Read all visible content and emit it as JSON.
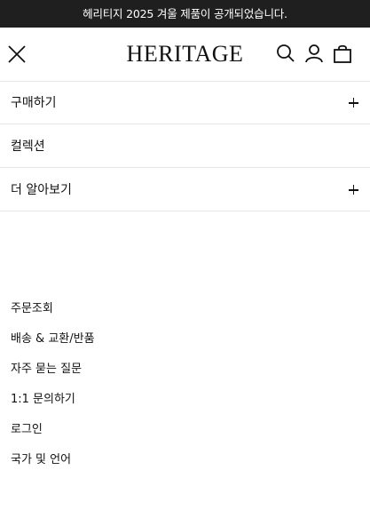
{
  "announcement": "헤리티지 2025 겨울 제품이 공개되었습니다.",
  "header": {
    "logo": "HERITAGE",
    "icons": [
      "close-icon",
      "search-icon",
      "account-icon",
      "bag-icon"
    ]
  },
  "menu": {
    "items": [
      {
        "label": "구매하기",
        "expandable": true
      },
      {
        "label": "컬렉션",
        "expandable": false
      },
      {
        "label": "더 알아보기",
        "expandable": true
      }
    ]
  },
  "footer_links": [
    "주문조회",
    "배송 & 교환/반품",
    "자주 묻는 질문",
    "1:1 문의하기",
    "로그인",
    "국가 및 언어"
  ],
  "colors": {
    "announcement_bg": "#1f1f1f",
    "announcement_text": "#ffffff",
    "text": "#111111",
    "divider": "#e6e6e6"
  }
}
